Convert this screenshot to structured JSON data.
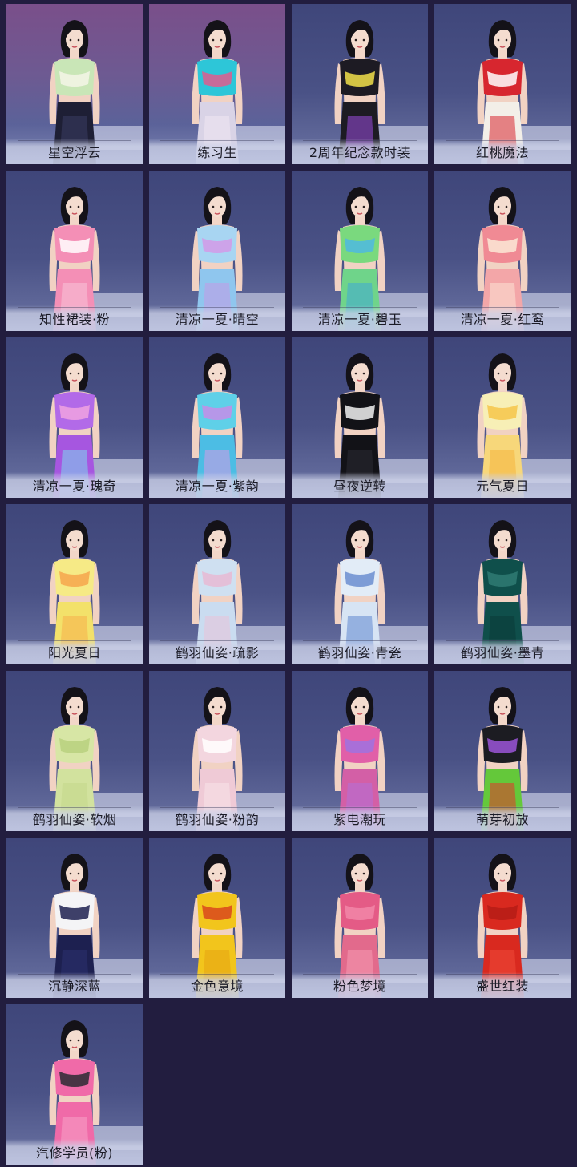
{
  "outfits": [
    {
      "name": "星空浮云",
      "theme": "purple",
      "top": "#c9e6b7",
      "top2": "#f5f5e8",
      "bottom": "#1e1f35",
      "bottom2": "#3a3c62"
    },
    {
      "name": "练习生",
      "theme": "purple",
      "top": "#2dc6d8",
      "top2": "#e25a8e",
      "bottom": "#d9d3e6",
      "bottom2": "#f0e8f2"
    },
    {
      "name": "2周年纪念款时装",
      "theme": "blue",
      "top": "#1d1b23",
      "top2": "#f2e14a",
      "bottom": "#1d1b23",
      "bottom2": "#9b4de0"
    },
    {
      "name": "红桃魔法",
      "theme": "blue",
      "top": "#d7262f",
      "top2": "#ffffff",
      "bottom": "#f3efe8",
      "bottom2": "#d7262f"
    },
    {
      "name": "知性裙装·粉",
      "theme": "blue",
      "top": "#f48fb6",
      "top2": "#ffffff",
      "bottom": "#f48fb6",
      "bottom2": "#f7c4d9"
    },
    {
      "name": "清凉一夏·晴空",
      "theme": "blue",
      "top": "#a8d5f2",
      "top2": "#d39ae8",
      "bottom": "#8fc6ee",
      "bottom2": "#c59be6"
    },
    {
      "name": "清凉一夏·碧玉",
      "theme": "blue",
      "top": "#7ad97e",
      "top2": "#4fb8e0",
      "bottom": "#6fd48a",
      "bottom2": "#3fa8d6"
    },
    {
      "name": "清凉一夏·红鸾",
      "theme": "blue",
      "top": "#f08a94",
      "top2": "#fbe7d6",
      "bottom": "#f3a6a8",
      "bottom2": "#fbe1d3"
    },
    {
      "name": "清凉一夏·瑰奇",
      "theme": "blue",
      "top": "#b26ae8",
      "top2": "#f0a2e0",
      "bottom": "#a656e0",
      "bottom2": "#7bd8ef"
    },
    {
      "name": "清凉一夏·紫韵",
      "theme": "blue",
      "top": "#5fd0e8",
      "top2": "#c58de8",
      "bottom": "#4cbde4",
      "bottom2": "#d59ae6"
    },
    {
      "name": "昼夜逆转",
      "theme": "blue",
      "top": "#121217",
      "top2": "#f2f2f2",
      "bottom": "#121217",
      "bottom2": "#2a2a33"
    },
    {
      "name": "元气夏日",
      "theme": "blue",
      "top": "#f7efb6",
      "top2": "#f6c54a",
      "bottom": "#f7d77a",
      "bottom2": "#f5b43c"
    },
    {
      "name": "阳光夏日",
      "theme": "blue",
      "top": "#f6ea86",
      "top2": "#f6a64c",
      "bottom": "#f3e16a",
      "bottom2": "#f5b04a"
    },
    {
      "name": "鹤羽仙姿·疏影",
      "theme": "blue",
      "top": "#cfe0f1",
      "top2": "#e7b9d3",
      "bottom": "#cadcf0",
      "bottom2": "#e9c2d8"
    },
    {
      "name": "鹤羽仙姿·青瓷",
      "theme": "blue",
      "top": "#e2ecf7",
      "top2": "#6b8ed0",
      "bottom": "#d7e4f4",
      "bottom2": "#5f86cf"
    },
    {
      "name": "鹤羽仙姿·墨青",
      "theme": "blue",
      "top": "#0f4f4b",
      "top2": "#2f7a73",
      "bottom": "#0f4f4b",
      "bottom2": "#0b3b38"
    },
    {
      "name": "鹤羽仙姿·软烟",
      "theme": "blue",
      "top": "#d7e6a5",
      "top2": "#b9d07e",
      "bottom": "#d2e29e",
      "bottom2": "#c3d78a"
    },
    {
      "name": "鹤羽仙姿·粉韵",
      "theme": "blue",
      "top": "#f3d6df",
      "top2": "#ffffff",
      "bottom": "#efcad6",
      "bottom2": "#f8e3ea"
    },
    {
      "name": "紫电潮玩",
      "theme": "blue",
      "top": "#e15fa8",
      "top2": "#9f72e0",
      "bottom": "#d35fa6",
      "bottom2": "#b36fd8"
    },
    {
      "name": "萌芽初放",
      "theme": "blue",
      "top": "#1c1c22",
      "top2": "#9b55d8",
      "bottom": "#64c83a",
      "bottom2": "#e3352c"
    },
    {
      "name": "沉静深蓝",
      "theme": "blue",
      "top": "#f4f4f6",
      "top2": "#1d2050",
      "bottom": "#1d2050",
      "bottom2": "#2c3170"
    },
    {
      "name": "金色意境",
      "theme": "blue",
      "top": "#f2c51c",
      "top2": "#d9461c",
      "bottom": "#f2c51c",
      "bottom2": "#e6a313"
    },
    {
      "name": "粉色梦境",
      "theme": "blue",
      "top": "#e45b86",
      "top2": "#f287a8",
      "bottom": "#e26a8c",
      "bottom2": "#f59ab3"
    },
    {
      "name": "盛世红装",
      "theme": "blue",
      "top": "#d9291f",
      "top2": "#b51c16",
      "bottom": "#d9291f",
      "bottom2": "#ef4a39"
    },
    {
      "name": "汽修学员(粉)",
      "theme": "blue",
      "top": "#f06aa8",
      "top2": "#2a2a33",
      "bottom": "#f06aa8",
      "bottom2": "#f7a0c7"
    }
  ]
}
